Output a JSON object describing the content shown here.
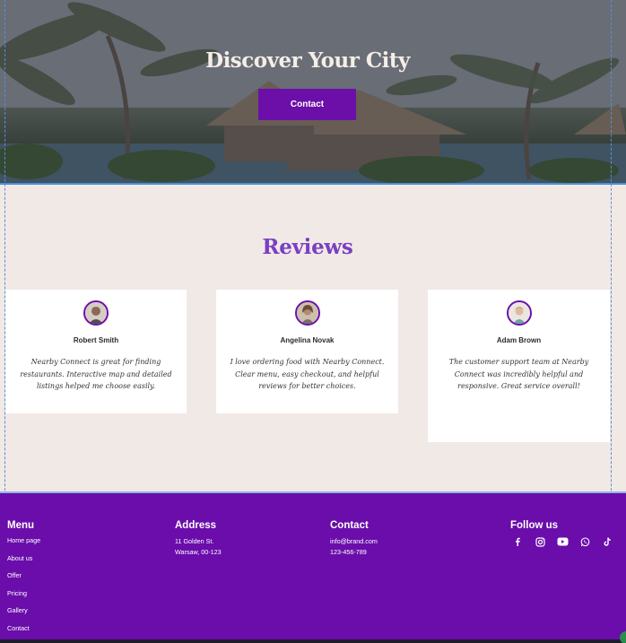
{
  "hero": {
    "title": "Discover Your City",
    "button_label": "Contact"
  },
  "reviews": {
    "title": "Reviews",
    "items": [
      {
        "name": "Robert Smith",
        "text": "Nearby Connect is great for finding restaurants. Interactive map and detailed listings helped me choose easily.",
        "avatar": "avatar-male-1"
      },
      {
        "name": "Angelina Novak",
        "text": "I love ordering food with Nearby Connect. Clear menu, easy checkout, and helpful reviews for better choices.",
        "avatar": "avatar-female-1"
      },
      {
        "name": "Adam Brown",
        "text": "The customer support team at Nearby Connect was incredibly helpful and responsive. Great service overall!",
        "avatar": "avatar-male-2"
      }
    ]
  },
  "footer": {
    "menu": {
      "title": "Menu",
      "items": [
        "Home page",
        "About us",
        "Offer",
        "Pricing",
        "Gallery",
        "Contact"
      ]
    },
    "address": {
      "title": "Address",
      "lines": [
        "11 Golden St.",
        "Warsaw, 00-123"
      ]
    },
    "contact": {
      "title": "Contact",
      "email": "info@brand.com",
      "phone": "123-456-789"
    },
    "follow": {
      "title": "Follow us",
      "icons": [
        "facebook-icon",
        "instagram-icon",
        "youtube-icon",
        "whatsapp-icon",
        "tiktok-icon"
      ]
    }
  },
  "colors": {
    "brand_purple": "#6a0dab",
    "reviews_title": "#7a3fc4",
    "section_bg": "#f1e9e5",
    "guide_blue": "#4a90d9"
  }
}
